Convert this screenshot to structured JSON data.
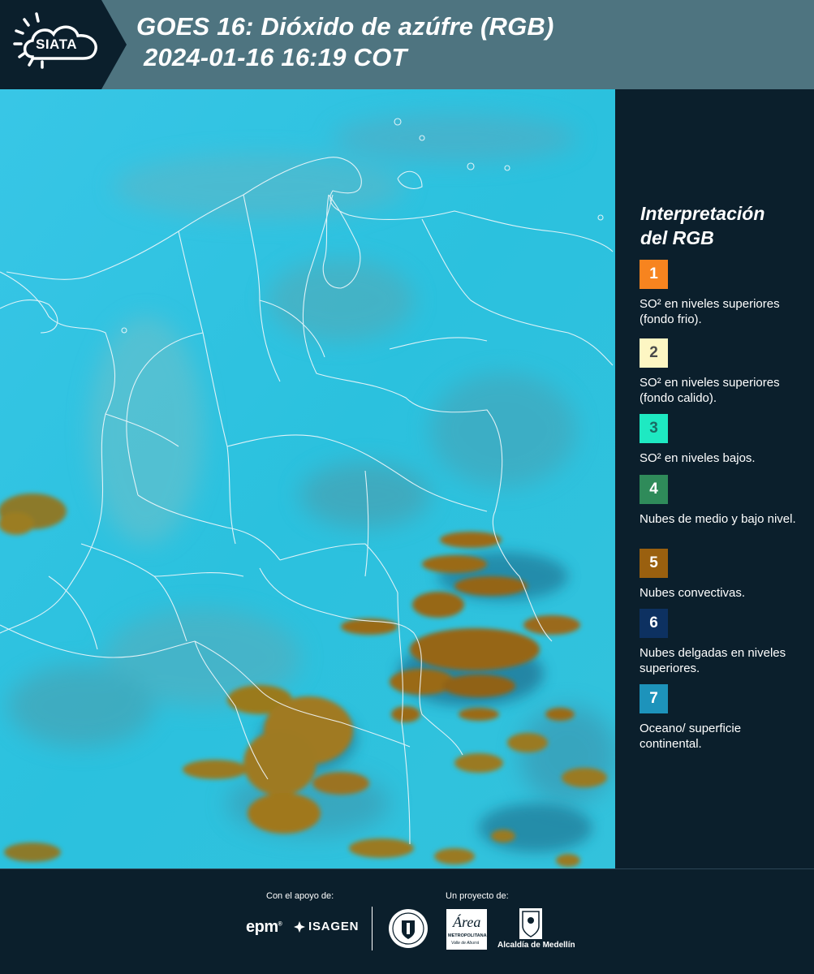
{
  "header": {
    "logo_text": "SIATA",
    "title_line1": "GOES 16: Dióxido de azúfre (RGB)",
    "title_line2": "2024-01-16 16:19 COT"
  },
  "legend": {
    "title_line1": "Interpretación",
    "title_line2": "del RGB",
    "items": [
      {
        "number": "1",
        "color": "#f7841f",
        "text_color": "#ffffff",
        "label": "SO² en niveles superiores (fondo frio)."
      },
      {
        "number": "2",
        "color": "#fdf6c3",
        "text_color": "#4a4a4a",
        "label": "SO² en niveles superiores (fondo calido)."
      },
      {
        "number": "3",
        "color": "#1ee9c2",
        "text_color": "#1a6b63",
        "label": "SO² en niveles bajos."
      },
      {
        "number": "4",
        "color": "#2f8b5a",
        "text_color": "#ffffff",
        "label": "Nubes de medio y bajo nivel."
      },
      {
        "number": "5",
        "color": "#9a600f",
        "text_color": "#ffffff",
        "label": "Nubes convectivas."
      },
      {
        "number": "6",
        "color": "#0d3161",
        "text_color": "#ffffff",
        "label": "Nubes delgadas en niveles superiores."
      },
      {
        "number": "7",
        "color": "#1d93bb",
        "text_color": "#ffffff",
        "label": "Oceano/ superficie continental."
      }
    ]
  },
  "footer": {
    "support_label": "Con el apoyo de:",
    "project_label": "Un proyecto de:",
    "epm_text": "epm",
    "isagen_text": "ISAGEN",
    "area_text": "Área",
    "area_subtext": "METROPOLITANA",
    "area_subtext2": "Valle de Aburrá",
    "alcaldia_text": "Alcaldía de Medellín"
  },
  "colors": {
    "header_bg": "#4e7480",
    "panel_bg": "#0b1f2c",
    "map_sea": "#29c2df",
    "cloud_convective": "#9a6b1e"
  }
}
